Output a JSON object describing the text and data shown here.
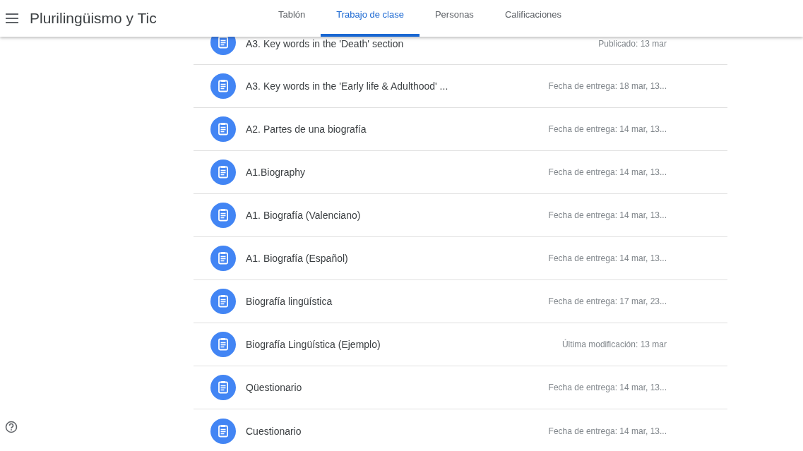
{
  "header": {
    "title": "Plurilingüismo y Tic",
    "tabs": [
      {
        "label": "Tablón",
        "selected": false
      },
      {
        "label": "Trabajo de clase",
        "selected": true
      },
      {
        "label": "Personas",
        "selected": false
      },
      {
        "label": "Calificaciones",
        "selected": false
      }
    ]
  },
  "assignments": [
    {
      "title": "A3. Key words in the 'Death' section",
      "meta": "Publicado: 13 mar"
    },
    {
      "title": "A3. Key words in the 'Early life & Adulthood' ...",
      "meta": "Fecha de entrega: 18 mar, 13..."
    },
    {
      "title": "A2. Partes de una biografía",
      "meta": "Fecha de entrega: 14 mar, 13..."
    },
    {
      "title": "A1.Biography",
      "meta": "Fecha de entrega: 14 mar, 13..."
    },
    {
      "title": "A1. Biografía (Valenciano)",
      "meta": "Fecha de entrega: 14 mar, 13..."
    },
    {
      "title": "A1. Biografía (Español)",
      "meta": "Fecha de entrega: 14 mar, 13..."
    },
    {
      "title": "Biografía lingüística",
      "meta": "Fecha de entrega: 17 mar, 23..."
    },
    {
      "title": "Biografía Lingüística (Ejemplo)",
      "meta": "Última modificación: 13 mar"
    },
    {
      "title": "Qüestionario",
      "meta": "Fecha de entrega: 14 mar, 13..."
    },
    {
      "title": "Cuestionario",
      "meta": "Fecha de entrega: 14 mar, 13..."
    }
  ]
}
